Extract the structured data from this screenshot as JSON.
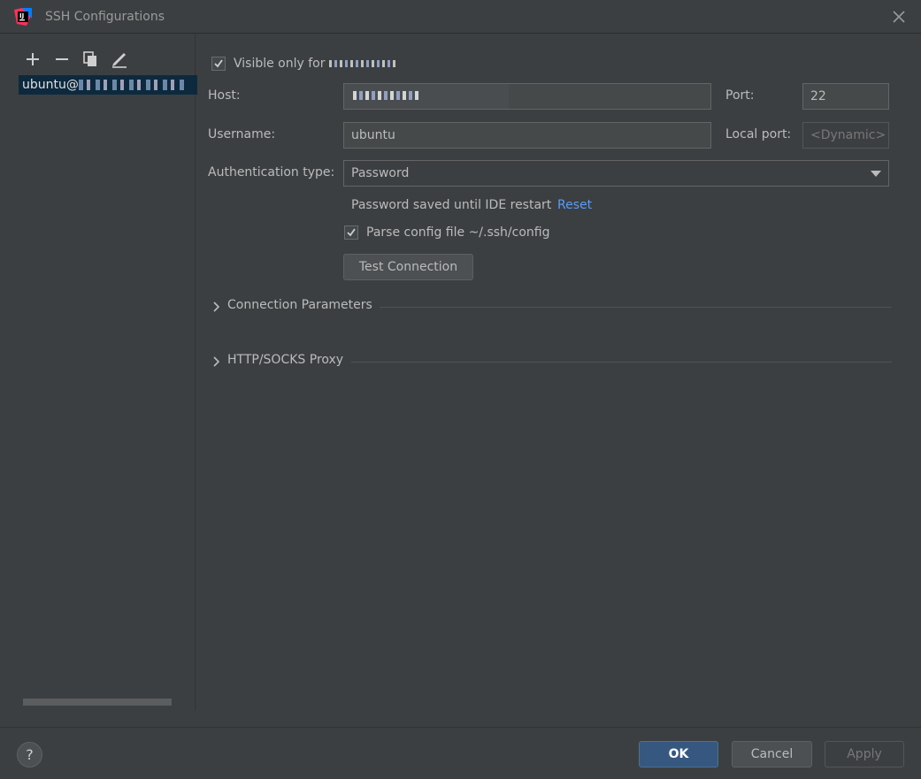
{
  "window": {
    "title": "SSH Configurations"
  },
  "toolbar": {
    "icons": [
      "add-icon",
      "remove-icon",
      "copy-icon",
      "edit-icon"
    ]
  },
  "config_list": {
    "items": [
      {
        "label": "ubuntu@"
      }
    ]
  },
  "form": {
    "visible_only_label": "Visible only for ",
    "visible_only_checked": true,
    "host_label": "Host:",
    "port_label": "Port:",
    "port_value": "22",
    "username_label": "Username:",
    "username_value": "ubuntu",
    "local_port_label": "Local port:",
    "local_port_placeholder": "<Dynamic>",
    "auth_type_label": "Authentication type:",
    "auth_type_value": "Password",
    "password_note": "Password saved until IDE restart",
    "reset_link": "Reset",
    "parse_config_label": "Parse config file ~/.ssh/config",
    "parse_config_checked": true,
    "test_connection_label": "Test Connection"
  },
  "sections": [
    {
      "label": "Connection Parameters"
    },
    {
      "label": "HTTP/SOCKS Proxy"
    }
  ],
  "footer": {
    "help_label": "?",
    "ok_label": "OK",
    "cancel_label": "Cancel",
    "apply_label": "Apply"
  },
  "colors": {
    "background": "#3c3f41",
    "selection": "#0d293e",
    "link": "#589df6",
    "primary_button": "#365880"
  }
}
